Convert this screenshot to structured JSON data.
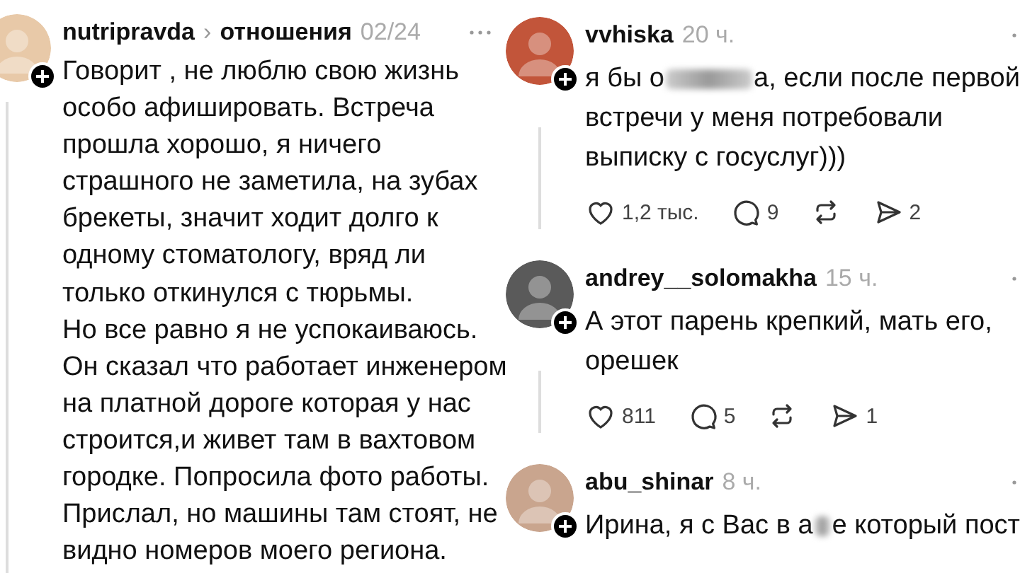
{
  "post": {
    "author": "nutripravda",
    "chevron": "›",
    "topic": "отношения",
    "date": "02/24",
    "lines": [
      "Говорит , не люблю свою жизнь",
      "особо афишировать. Встреча",
      "прошла хорошо, я ничего",
      "страшного не заметила, на зубах",
      "брекеты, значит ходит долго к",
      "одному стоматологу, вряд ли",
      "только откинулся с тюрьмы.",
      "Но все равно я не успокаиваюсь.",
      "Он сказал что работает инженером",
      "на платной дороге которая у нас",
      "строится,и живет там в вахтовом",
      "городке. Попросила фото работы.",
      "Прислал, но машины там стоят, не",
      "видно номеров моего региона."
    ]
  },
  "comments": [
    {
      "author": "vvhiska",
      "time": "20 ч.",
      "lines": [
        [
          {
            "kind": "text",
            "text": "я бы о"
          },
          {
            "kind": "wideblur"
          },
          {
            "kind": "text",
            "text": "а, если после первой"
          }
        ],
        [
          {
            "kind": "text",
            "text": "встречи у меня потребовали"
          }
        ],
        [
          {
            "kind": "text",
            "text": "выписку с госуслуг)))"
          }
        ]
      ],
      "actions": [
        {
          "kind": "like",
          "count": "1,2 тыс."
        },
        {
          "kind": "reply",
          "count": "9"
        },
        {
          "kind": "repost"
        },
        {
          "kind": "share",
          "count": "2"
        }
      ]
    },
    {
      "author": "andrey__solomakha",
      "time": "15 ч.",
      "lines": [
        [
          {
            "kind": "text",
            "text": "А этот парень крепкий, мать его,"
          }
        ],
        [
          {
            "kind": "text",
            "text": "орешек"
          }
        ]
      ],
      "actions": [
        {
          "kind": "like",
          "count": "811"
        },
        {
          "kind": "reply",
          "count": "5"
        },
        {
          "kind": "repost"
        },
        {
          "kind": "share",
          "count": "1"
        }
      ]
    },
    {
      "author": "abu_shinar",
      "time": "8 ч.",
      "lines": [
        [
          {
            "kind": "text",
            "text": "Ирина, я с Вас в а"
          },
          {
            "kind": "narrowblur"
          },
          {
            "kind": "text",
            "text": "е который пост"
          }
        ]
      ]
    }
  ]
}
